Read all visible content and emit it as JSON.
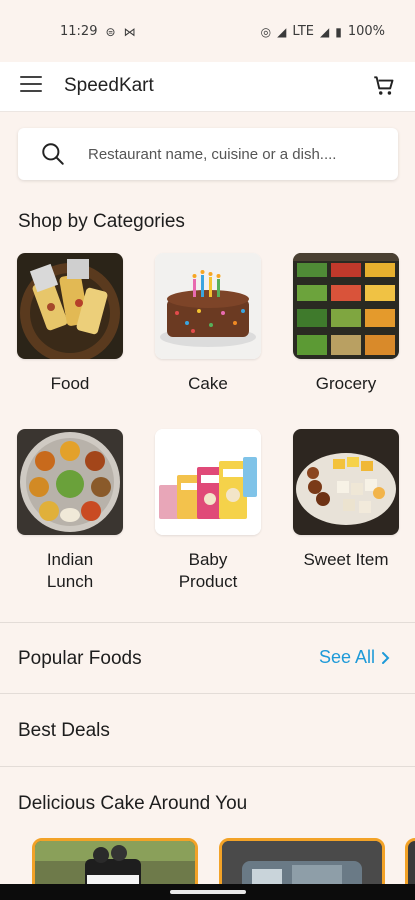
{
  "status": {
    "time": "11:29",
    "network": "LTE",
    "battery": "100%"
  },
  "appbar": {
    "title": "SpeedKart"
  },
  "search": {
    "placeholder": "Restaurant name, cuisine or a dish...."
  },
  "categories": {
    "title": "Shop by Categories",
    "items": [
      {
        "label": "Food"
      },
      {
        "label": "Cake"
      },
      {
        "label": "Grocery"
      },
      {
        "label": "Indian\nLunch"
      },
      {
        "label": "Baby\nProduct"
      },
      {
        "label": "Sweet Item"
      }
    ]
  },
  "popular": {
    "title": "Popular Foods",
    "see_all": "See All"
  },
  "best_deals": {
    "title": "Best Deals"
  },
  "cakes": {
    "title": "Delicious Cake Around You"
  },
  "colors": {
    "accent": "#1e9ad8",
    "card_border": "#f2a227",
    "background": "#fbf3ee"
  }
}
